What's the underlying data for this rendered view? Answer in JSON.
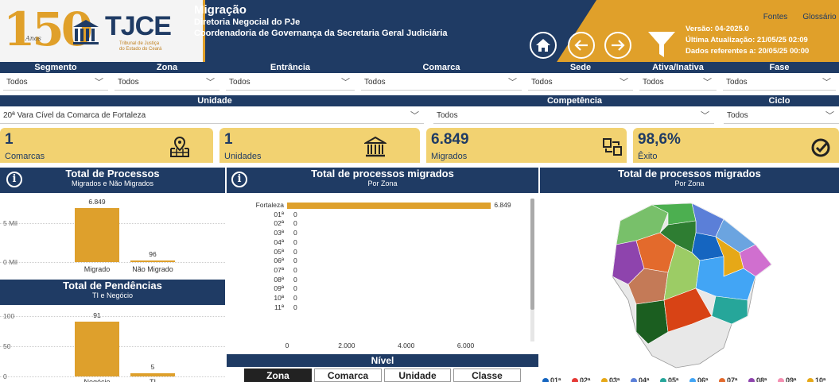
{
  "header": {
    "title": "Migração",
    "subtitle1": "Diretoria Negocial do PJe",
    "subtitle2": "Coordenadoria de Governança da Secretaria Geral Judiciária",
    "logo_text": "TJCE",
    "logo_150": "150",
    "logo_anos": "Anos",
    "logo_sub1": "Tribunal de Justiça",
    "logo_sub2": "do Estado do Ceará",
    "version": "Versão: 04-2025.0",
    "last_update": "Última Atualização: 21/05/25 02:09",
    "data_ref": "Dados referentes a: 20/05/25 00:00",
    "btn_fontes": "Fontes",
    "btn_glossario": "Glossário",
    "colors": {
      "navy": "#1f3b64",
      "gold": "#e0a02a"
    }
  },
  "filters1": [
    {
      "label": "Segmento",
      "value": "Todos"
    },
    {
      "label": "Zona",
      "value": "Todos"
    },
    {
      "label": "Entrância",
      "value": "Todos"
    },
    {
      "label": "Comarca",
      "value": "Todos"
    },
    {
      "label": "Sede",
      "value": "Todos"
    },
    {
      "label": "Ativa/Inativa",
      "value": "Todos"
    },
    {
      "label": "Fase",
      "value": "Todos"
    }
  ],
  "filters2": {
    "unidade_label": "Unidade",
    "unidade_value": "20ª Vara Cível da Comarca de Fortaleza",
    "competencia_label": "Competência",
    "competencia_value": "Todos",
    "ciclo_label": "Ciclo",
    "ciclo_value": "Todos"
  },
  "kpis": [
    {
      "value": "1",
      "label": "Comarcas",
      "icon": "map-pin-icon"
    },
    {
      "value": "1",
      "label": "Unidades",
      "icon": "courthouse-icon"
    },
    {
      "value": "6.849",
      "label": "Migrados",
      "icon": "transfer-icon"
    },
    {
      "value": "98,6%",
      "label": "Êxito",
      "icon": "check-circle-icon"
    }
  ],
  "panel_processos": {
    "title": "Total de Processos",
    "subtitle": "Migrados e Não Migrados",
    "ticks": [
      "5 Mil",
      "0 Mil"
    ]
  },
  "panel_pendencias": {
    "title": "Total de Pendências",
    "subtitle": "TI e Negócio",
    "ticks": [
      "100",
      "50",
      "0"
    ]
  },
  "panel_zona": {
    "title": "Total de processos migrados",
    "subtitle": "Por Zona",
    "xticks": [
      "0",
      "2.000",
      "4.000",
      "6.000"
    ],
    "footer": "Nível"
  },
  "panel_map": {
    "title": "Total de processos migrados",
    "subtitle": "Por Zona"
  },
  "nivel_buttons": [
    "Zona",
    "Comarca",
    "Unidade",
    "Classe"
  ],
  "map_legend": [
    "01ª",
    "02ª",
    "03ª",
    "04ª",
    "05ª",
    "06ª",
    "07ª",
    "08ª",
    "09ª",
    "10ª"
  ],
  "chart_data": [
    {
      "type": "bar",
      "title": "Total de Processos",
      "categories": [
        "Migrado",
        "Não Migrado"
      ],
      "values": [
        6849,
        96
      ],
      "data_labels": [
        "6.849",
        "96"
      ],
      "ylim": [
        0,
        7000
      ]
    },
    {
      "type": "bar",
      "title": "Total de Pendências",
      "categories": [
        "Negócio",
        "TI"
      ],
      "values": [
        91,
        5
      ],
      "data_labels": [
        "91",
        "5"
      ],
      "ylim": [
        0,
        100
      ]
    },
    {
      "type": "bar",
      "orientation": "horizontal",
      "title": "Total de processos migrados",
      "categories": [
        "Fortaleza",
        "01ª",
        "02ª",
        "03ª",
        "04ª",
        "05ª",
        "06ª",
        "07ª",
        "08ª",
        "09ª",
        "10ª",
        "11ª"
      ],
      "values": [
        6849,
        0,
        0,
        0,
        0,
        0,
        0,
        0,
        0,
        0,
        0,
        0
      ],
      "data_labels": [
        "6.849",
        "0",
        "0",
        "0",
        "0",
        "0",
        "0",
        "0",
        "0",
        "0",
        "0",
        "0"
      ],
      "xlim": [
        0,
        7000
      ]
    }
  ]
}
